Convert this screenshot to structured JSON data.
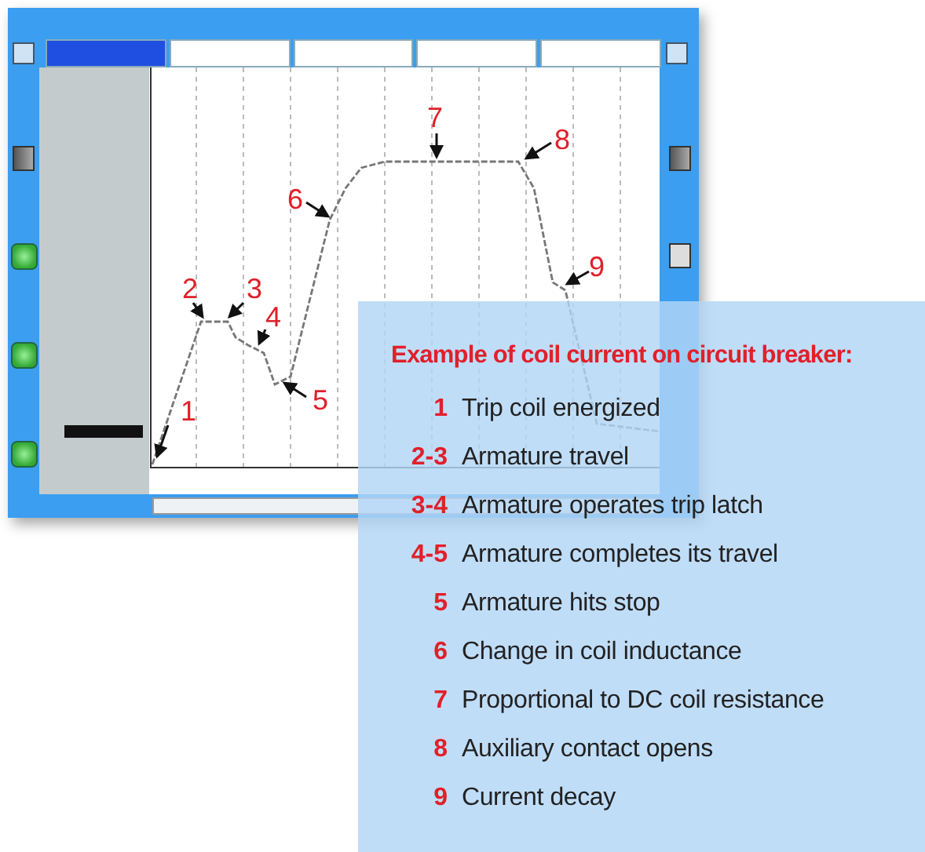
{
  "window": {
    "tabs": [
      {
        "selected": true
      },
      {
        "selected": false
      },
      {
        "selected": false
      },
      {
        "selected": false
      },
      {
        "selected": false
      }
    ]
  },
  "plot": {
    "callouts": [
      "1",
      "2",
      "3",
      "4",
      "5",
      "6",
      "7",
      "8",
      "9"
    ]
  },
  "legend": {
    "title": "Example of coil current on circuit breaker:",
    "items": [
      {
        "number": "1",
        "text": "Trip coil energized"
      },
      {
        "number": "2-3",
        "text": "Armature travel"
      },
      {
        "number": "3-4",
        "text": "Armature operates trip latch"
      },
      {
        "number": "4-5",
        "text": "Armature completes its travel"
      },
      {
        "number": "5",
        "text": "Armature hits stop"
      },
      {
        "number": "6",
        "text": "Change in coil inductance"
      },
      {
        "number": "7",
        "text": "Proportional to DC coil resistance"
      },
      {
        "number": "8",
        "text": "Auxiliary contact opens"
      },
      {
        "number": "9",
        "text": "Current decay"
      }
    ]
  }
}
